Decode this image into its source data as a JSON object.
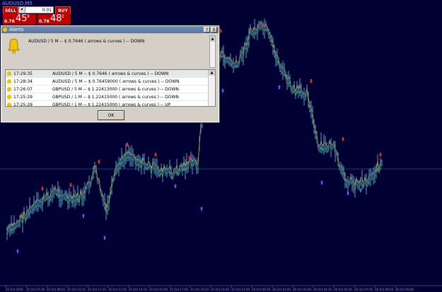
{
  "window": {
    "title": "AUDUSD,M5"
  },
  "trade_panel": {
    "sell_label": "SELL",
    "buy_label": "BUY",
    "lot_decrement": "▾",
    "lot_value": "0.01",
    "sell_price_small": "0.76",
    "sell_price_big": "45",
    "sell_price_sup": "9",
    "buy_price_small": "0.76",
    "buy_price_big": "48",
    "buy_price_sup": "2"
  },
  "alerts_dialog": {
    "title": "Alerts",
    "help_button": "?",
    "close_button": "X",
    "current_message": "AUDUSD / 5 M -- $ 0.7646 (  arrows & curves  ) -- DOWN",
    "ok_label": "OK",
    "scroll_up": "▲",
    "scroll_down": "▼",
    "rows": [
      {
        "time": "17:29:35",
        "message": "AUDUSD / 5 M -- $ 0.7646 (  arrows & curves  ) -- DOWN"
      },
      {
        "time": "17:28:34",
        "message": "AUDUSD / 5 M -- $ 0.76459000 (  arrows & curves  ) -- DOWN"
      },
      {
        "time": "17:26:07",
        "message": "GBPUSD / 5 M -- $ 1.22413000 (  arrows & curves  ) -- DOWN"
      },
      {
        "time": "17:25:29",
        "message": "GBPUSD / 1 M -- $ 1.22415000 (  arrows & curves  ) -- DOWN"
      },
      {
        "time": "17:25:29",
        "message": "GBPUSD / 1 M -- $ 1.22415000 (  arrows & curves  ) -- UP"
      }
    ]
  },
  "chart": {
    "background": "#000033",
    "price_line_color": "#5f6fb5",
    "candle_color": "#4fa3c4",
    "down_arrow_color": "#ff2020",
    "up_arrow_color": "#3a6bff",
    "curve_colors": [
      "#2e8b57",
      "#c8a040"
    ],
    "time_labels": [
      "25 Oct 2016",
      "25 Oct 07:30",
      "25 Oct 08:55",
      "25 Oct 10:15",
      "25 Oct 11:35",
      "25 Oct 12:55",
      "25 Oct 14:15",
      "25 Oct 15:40",
      "25 Oct 17:00",
      "25 Oct 18:20",
      "25 Oct 19:40",
      "25 Oct 21:00",
      "26 Oct 00:20",
      "26 Oct 01:45",
      "26 Oct 03:00",
      "26 Oct 04:25",
      "26 Oct 05:45",
      "26 Oct 07:05",
      "26 Oct 08:25",
      "26 Oct 09:45"
    ]
  }
}
